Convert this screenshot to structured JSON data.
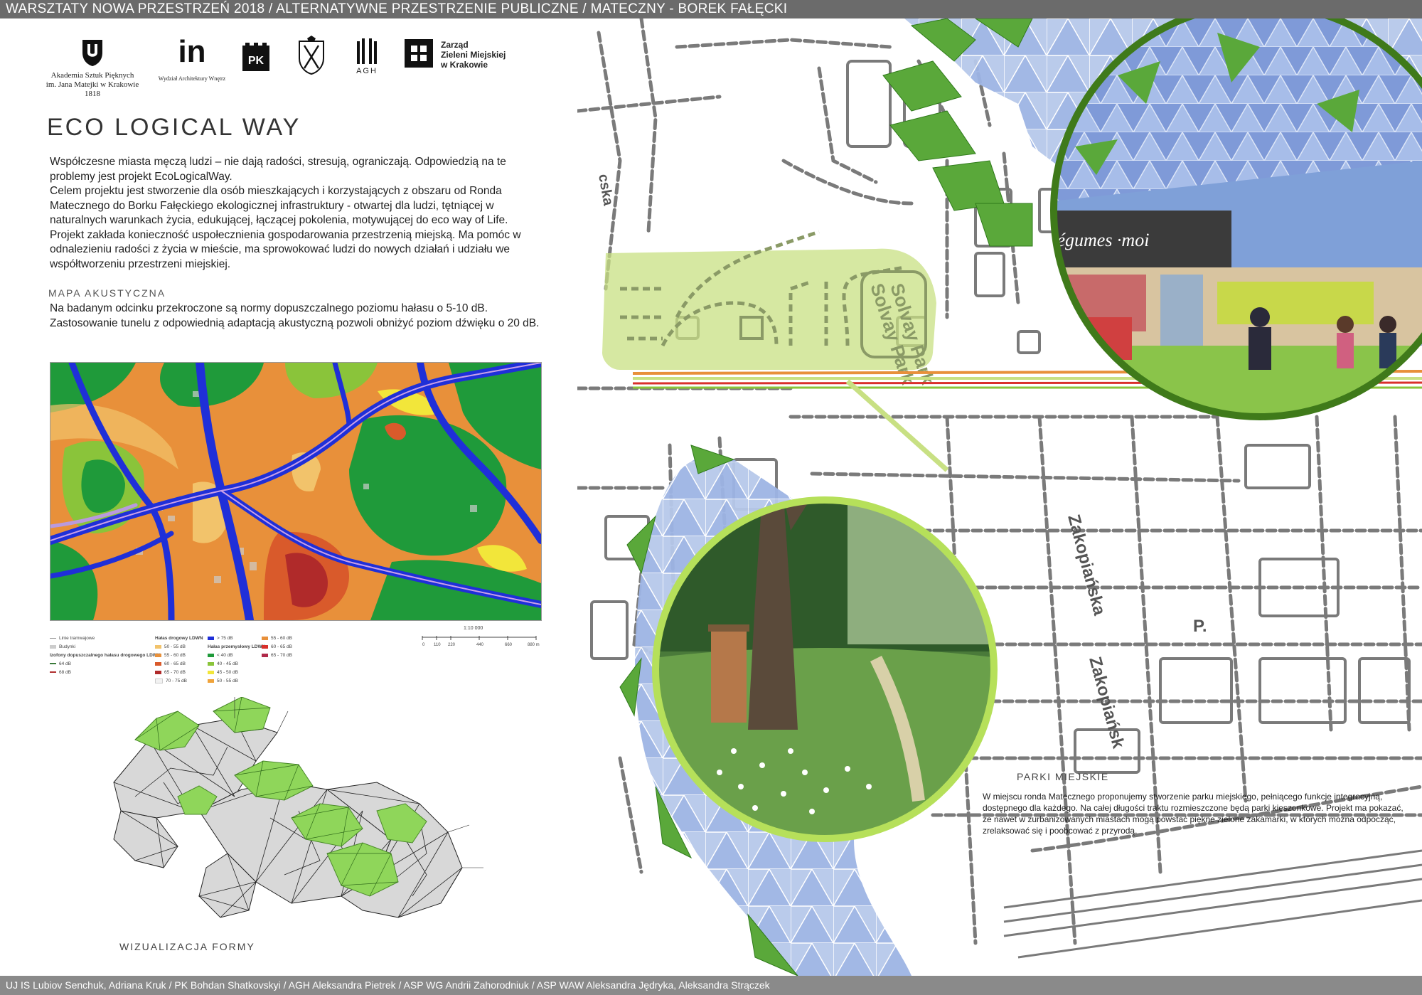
{
  "header": {
    "title": "WARSZTATY NOWA PRZESTRZEŃ 2018 / ALTERNATYWNE PRZESTRZENIE PUBLICZNE / MATECZNY - BOREK FAŁĘCKI"
  },
  "logos": {
    "asp_line1": "Akademia Sztuk Pięknych",
    "asp_line2": "im. Jana Matejki w Krakowie",
    "asp_line3": "1818",
    "in_mark": "in",
    "in_caption": "Wydział Architektury Wnętrz",
    "pk_mark": "PK",
    "agh_mark": "AGH",
    "zzm_line1": "Zarząd",
    "zzm_line2": "Zieleni Miejskiej",
    "zzm_line3": "w Krakowie"
  },
  "title": "ECO LOGICAL  WAY",
  "intro": {
    "p1": "Współczesne miasta męczą ludzi –  nie dają radości, stresują, ograniczają. Odpowiedzią na te problemy jest projekt EcoLogicalWay.",
    "p2": "  Celem projektu jest stworzenie dla osób mieszkających i korzystających z obszaru od Ronda Matecznego do Borku Fałęckiego ekologicznej infrastruktury - otwartej dla ludzi, tętniącej w naturalnych warunkach życia, edukującej, łączącej pokolenia, motywującej do eco way of Life.",
    "p3": "  Projekt zakłada konieczność uspołecznienia gospodarowania przestrzenią miejską. Ma pomóc w odnalezieniu radości z życia w mieście, ma  sprowokować ludzi do nowych działań i udziału we współtworzeniu przestrzeni miejskiej."
  },
  "acoustic": {
    "label": "MAPA AKUSTYCZNA",
    "p1": "Na badanym odcinku przekroczone są normy dopuszczalnego poziomu hałasu o 5-10 dB.",
    "p2": "Zastosowanie tunelu z odpowiednią adaptacją akustyczną pozwoli obniżyć poziom dźwięku o 20 dB."
  },
  "legend": {
    "col1": [
      "Linie tramwajowe",
      "Budynki",
      "Izofony dopuszczalnego hałasu drogowego LDWN",
      "64 dB",
      "68 dB"
    ],
    "col2_title": "Hałas drogowy LDWN",
    "col2": [
      "50 - 55 dB",
      "55 - 60 dB",
      "60 - 65 dB",
      "65 - 70 dB",
      "70 - 75 dB"
    ],
    "col3": [
      "> 75 dB",
      "Hałas przemysłowy LDWN",
      "< 40 dB",
      "40 - 45 dB",
      "45 - 50 dB",
      "50 - 55 dB"
    ],
    "col4": [
      "55 - 60 dB",
      "60 - 65 dB",
      "65 - 70 dB"
    ],
    "scale_title": "1:10 000",
    "scale_ticks": [
      "0",
      "110",
      "220",
      "440",
      "660",
      "880 m"
    ],
    "colors": {
      "tram": "#999999",
      "buildings": "#cccccc",
      "iso64": "#3a7a3a",
      "iso68": "#b03030",
      "r50": "#f2c36b",
      "r55": "#e8903a",
      "r60": "#d95a2b",
      "r65": "#b02a2a",
      "r70": "#f2f2f2",
      "r75": "#1f2fd8",
      "i40": "#1f9a3a",
      "i45": "#8ac43a",
      "i50": "#f2e63a",
      "i55": "#f0a33a",
      "i60": "#d9302b",
      "i65": "#b02a4a",
      "i70": "#8a1a3a"
    }
  },
  "form_label": "WIZUALIZACJA FORMY",
  "map": {
    "park_name": "Solvay Park",
    "street1": "Zakopiańska",
    "street2": "Zakopiańsk",
    "p_marker": "P.",
    "street_left": "cska",
    "market_sign": "Légumes ·moi"
  },
  "parks": {
    "label": "PARKI MIEJSKIE",
    "text": "W miejscu ronda Matecznego proponujemy stworzenie parku miejskiego, pełniącego funkcje integracyjną, dostępnego dla każdego.  Na całej długości traktu rozmieszczone będą parki kieszonkowe. Projekt ma pokazać, że nawet w zurbanizowanych miastach mogą powstać piękne zielone zakamarki, w których można odpocząć, zrelaksować się i poobcować z przyrodą."
  },
  "footer": {
    "text": "UJ IS Lubiov Senchuk, Adriana Kruk / PK Bohdan Shatkovskyi / AGH Aleksandra Pietrek / ASP WG Andrii Zahorodniuk / ASP WAW Aleksandra Jędryka, Aleksandra Strączek"
  }
}
